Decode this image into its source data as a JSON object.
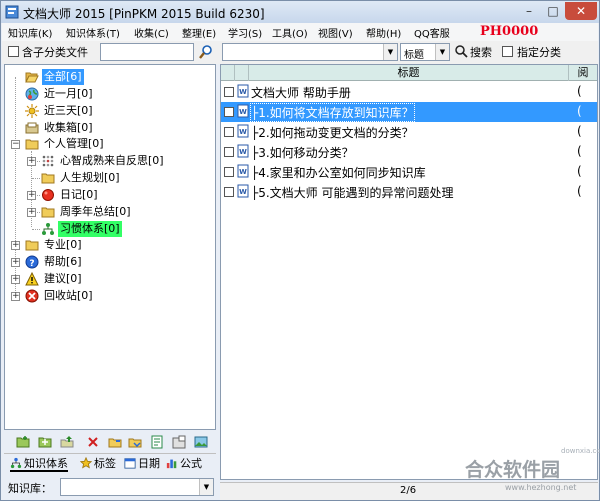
{
  "window": {
    "title": "文档大师 2015 [PinPKM 2015 Build 6230]"
  },
  "menu": {
    "items": [
      {
        "label": "知识库(K)"
      },
      {
        "label": "知识体系(T)"
      },
      {
        "label": "收集(C)"
      },
      {
        "label": "整理(E)"
      },
      {
        "label": "学习(S)"
      },
      {
        "label": "工具(O)"
      },
      {
        "label": "视图(V)"
      },
      {
        "label": "帮助(H)"
      },
      {
        "label": "QQ客服"
      }
    ],
    "code": "PH0000"
  },
  "toolbar": {
    "include_sub_label": "含子分类文件",
    "filter_value": "",
    "keyword_value": "",
    "field_value": "标题",
    "search_label": "搜索",
    "specify_category_label": "指定分类"
  },
  "tree": {
    "nodes": [
      {
        "label": "全部[6]",
        "icon": "folder-open-icon"
      },
      {
        "label": "近一月[0]",
        "icon": "globe-icon"
      },
      {
        "label": "近三天[0]",
        "icon": "sun-icon"
      },
      {
        "label": "收集箱[0]",
        "icon": "inbox-icon"
      },
      {
        "label": "个人管理[0]",
        "icon": "folder-icon"
      },
      {
        "label": "心智成熟来自反思[0]",
        "icon": "dots-icon"
      },
      {
        "label": "人生规划[0]",
        "icon": "folder-icon"
      },
      {
        "label": "日记[0]",
        "icon": "red-dot-icon"
      },
      {
        "label": "周季年总结[0]",
        "icon": "folder-icon"
      },
      {
        "label": "习惯体系[0]",
        "icon": "hierarchy-icon"
      },
      {
        "label": "专业[0]",
        "icon": "folder-icon"
      },
      {
        "label": "帮助[6]",
        "icon": "help-icon"
      },
      {
        "label": "建议[0]",
        "icon": "warning-icon"
      },
      {
        "label": "回收站[0]",
        "icon": "recycle-icon"
      }
    ]
  },
  "left_tabs": [
    {
      "label": "知识体系",
      "icon": "hierarchy-icon"
    },
    {
      "label": "标签",
      "icon": "star-icon"
    },
    {
      "label": "日期",
      "icon": "calendar-icon"
    },
    {
      "label": "公式",
      "icon": "bar-chart-icon"
    }
  ],
  "kb_row": {
    "label": "知识库：",
    "value": ""
  },
  "grid": {
    "header_title": "标题",
    "header_tail": "阅",
    "rows": [
      {
        "title": "文档大师 帮助手册",
        "tail": "("
      },
      {
        "title": "├1.如何将文档存放到知识库？",
        "tail": "("
      },
      {
        "title": "├2.如何拖动变更文档的分类？",
        "tail": "("
      },
      {
        "title": "├3.如何移动分类？",
        "tail": "("
      },
      {
        "title": "├4.家里和办公室如何同步知识库",
        "tail": "("
      },
      {
        "title": "├5.文档大师 可能遇到的异常问题处理",
        "tail": "("
      }
    ]
  },
  "status": {
    "page": "2/6"
  },
  "watermark": {
    "name": "合众软件园",
    "url": "www.hezhong.net",
    "tag": "downxia.com"
  },
  "colors": {
    "selection_blue": "#3399ff",
    "selection_green": "#33ff66",
    "code_red": "#e8001c"
  }
}
